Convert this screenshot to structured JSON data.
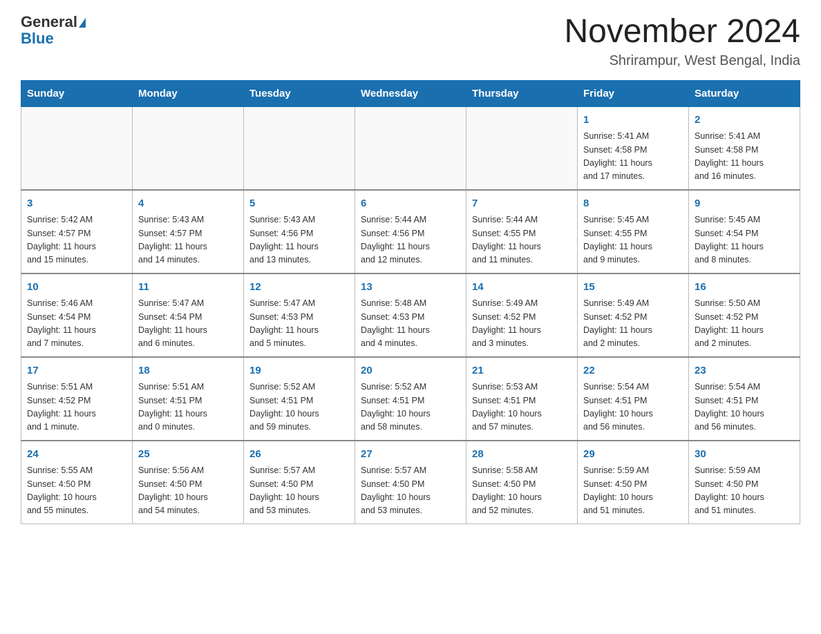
{
  "header": {
    "logo_line1": "General",
    "logo_line2": "Blue",
    "month_title": "November 2024",
    "location": "Shrirampur, West Bengal, India"
  },
  "weekdays": [
    "Sunday",
    "Monday",
    "Tuesday",
    "Wednesday",
    "Thursday",
    "Friday",
    "Saturday"
  ],
  "rows": [
    {
      "cells": [
        {
          "day": "",
          "info": ""
        },
        {
          "day": "",
          "info": ""
        },
        {
          "day": "",
          "info": ""
        },
        {
          "day": "",
          "info": ""
        },
        {
          "day": "",
          "info": ""
        },
        {
          "day": "1",
          "info": "Sunrise: 5:41 AM\nSunset: 4:58 PM\nDaylight: 11 hours\nand 17 minutes."
        },
        {
          "day": "2",
          "info": "Sunrise: 5:41 AM\nSunset: 4:58 PM\nDaylight: 11 hours\nand 16 minutes."
        }
      ]
    },
    {
      "cells": [
        {
          "day": "3",
          "info": "Sunrise: 5:42 AM\nSunset: 4:57 PM\nDaylight: 11 hours\nand 15 minutes."
        },
        {
          "day": "4",
          "info": "Sunrise: 5:43 AM\nSunset: 4:57 PM\nDaylight: 11 hours\nand 14 minutes."
        },
        {
          "day": "5",
          "info": "Sunrise: 5:43 AM\nSunset: 4:56 PM\nDaylight: 11 hours\nand 13 minutes."
        },
        {
          "day": "6",
          "info": "Sunrise: 5:44 AM\nSunset: 4:56 PM\nDaylight: 11 hours\nand 12 minutes."
        },
        {
          "day": "7",
          "info": "Sunrise: 5:44 AM\nSunset: 4:55 PM\nDaylight: 11 hours\nand 11 minutes."
        },
        {
          "day": "8",
          "info": "Sunrise: 5:45 AM\nSunset: 4:55 PM\nDaylight: 11 hours\nand 9 minutes."
        },
        {
          "day": "9",
          "info": "Sunrise: 5:45 AM\nSunset: 4:54 PM\nDaylight: 11 hours\nand 8 minutes."
        }
      ]
    },
    {
      "cells": [
        {
          "day": "10",
          "info": "Sunrise: 5:46 AM\nSunset: 4:54 PM\nDaylight: 11 hours\nand 7 minutes."
        },
        {
          "day": "11",
          "info": "Sunrise: 5:47 AM\nSunset: 4:54 PM\nDaylight: 11 hours\nand 6 minutes."
        },
        {
          "day": "12",
          "info": "Sunrise: 5:47 AM\nSunset: 4:53 PM\nDaylight: 11 hours\nand 5 minutes."
        },
        {
          "day": "13",
          "info": "Sunrise: 5:48 AM\nSunset: 4:53 PM\nDaylight: 11 hours\nand 4 minutes."
        },
        {
          "day": "14",
          "info": "Sunrise: 5:49 AM\nSunset: 4:52 PM\nDaylight: 11 hours\nand 3 minutes."
        },
        {
          "day": "15",
          "info": "Sunrise: 5:49 AM\nSunset: 4:52 PM\nDaylight: 11 hours\nand 2 minutes."
        },
        {
          "day": "16",
          "info": "Sunrise: 5:50 AM\nSunset: 4:52 PM\nDaylight: 11 hours\nand 2 minutes."
        }
      ]
    },
    {
      "cells": [
        {
          "day": "17",
          "info": "Sunrise: 5:51 AM\nSunset: 4:52 PM\nDaylight: 11 hours\nand 1 minute."
        },
        {
          "day": "18",
          "info": "Sunrise: 5:51 AM\nSunset: 4:51 PM\nDaylight: 11 hours\nand 0 minutes."
        },
        {
          "day": "19",
          "info": "Sunrise: 5:52 AM\nSunset: 4:51 PM\nDaylight: 10 hours\nand 59 minutes."
        },
        {
          "day": "20",
          "info": "Sunrise: 5:52 AM\nSunset: 4:51 PM\nDaylight: 10 hours\nand 58 minutes."
        },
        {
          "day": "21",
          "info": "Sunrise: 5:53 AM\nSunset: 4:51 PM\nDaylight: 10 hours\nand 57 minutes."
        },
        {
          "day": "22",
          "info": "Sunrise: 5:54 AM\nSunset: 4:51 PM\nDaylight: 10 hours\nand 56 minutes."
        },
        {
          "day": "23",
          "info": "Sunrise: 5:54 AM\nSunset: 4:51 PM\nDaylight: 10 hours\nand 56 minutes."
        }
      ]
    },
    {
      "cells": [
        {
          "day": "24",
          "info": "Sunrise: 5:55 AM\nSunset: 4:50 PM\nDaylight: 10 hours\nand 55 minutes."
        },
        {
          "day": "25",
          "info": "Sunrise: 5:56 AM\nSunset: 4:50 PM\nDaylight: 10 hours\nand 54 minutes."
        },
        {
          "day": "26",
          "info": "Sunrise: 5:57 AM\nSunset: 4:50 PM\nDaylight: 10 hours\nand 53 minutes."
        },
        {
          "day": "27",
          "info": "Sunrise: 5:57 AM\nSunset: 4:50 PM\nDaylight: 10 hours\nand 53 minutes."
        },
        {
          "day": "28",
          "info": "Sunrise: 5:58 AM\nSunset: 4:50 PM\nDaylight: 10 hours\nand 52 minutes."
        },
        {
          "day": "29",
          "info": "Sunrise: 5:59 AM\nSunset: 4:50 PM\nDaylight: 10 hours\nand 51 minutes."
        },
        {
          "day": "30",
          "info": "Sunrise: 5:59 AM\nSunset: 4:50 PM\nDaylight: 10 hours\nand 51 minutes."
        }
      ]
    }
  ]
}
